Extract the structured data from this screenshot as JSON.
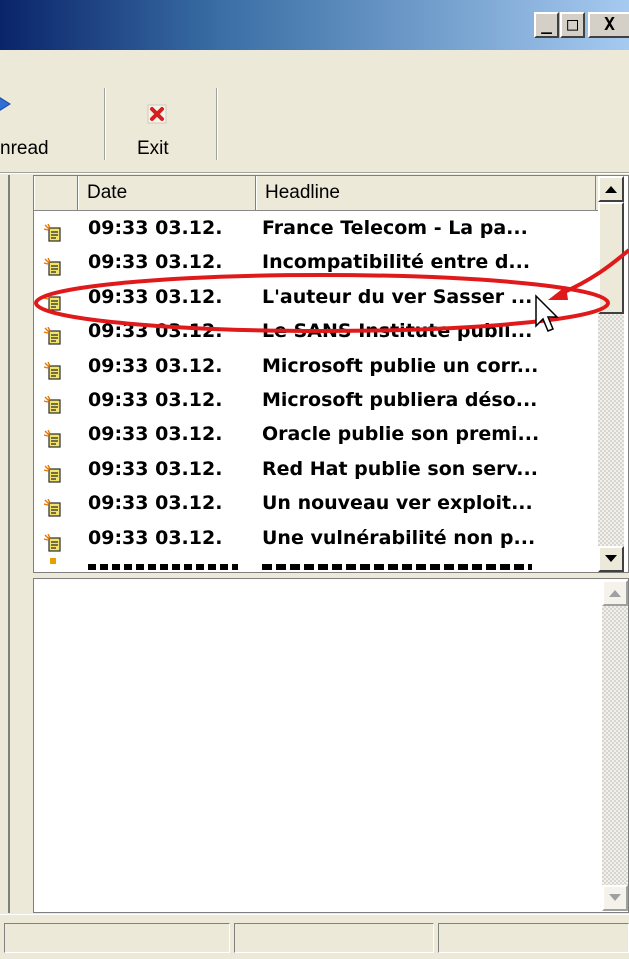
{
  "window": {
    "minimize_glyph": "_",
    "maximize_glyph": "□",
    "close_glyph": "X"
  },
  "toolbar": {
    "mark_unread_label": "nread",
    "exit_label": "Exit"
  },
  "list": {
    "columns": [
      "Date",
      "Headline"
    ],
    "rows": [
      {
        "date": "09:33 03.12.",
        "headline": "France Telecom - La pa..."
      },
      {
        "date": "09:33 03.12.",
        "headline": "Incompatibilité entre d..."
      },
      {
        "date": "09:33 03.12.",
        "headline": "L'auteur du ver Sasser ..."
      },
      {
        "date": "09:33 03.12.",
        "headline": "Le SANS Institute publi..."
      },
      {
        "date": "09:33 03.12.",
        "headline": "Microsoft publie un corr..."
      },
      {
        "date": "09:33 03.12.",
        "headline": "Microsoft publiera déso..."
      },
      {
        "date": "09:33 03.12.",
        "headline": "Oracle publie son premi..."
      },
      {
        "date": "09:33 03.12.",
        "headline": "Red Hat publie son serv..."
      },
      {
        "date": "09:33 03.12.",
        "headline": "Un nouveau ver exploit..."
      },
      {
        "date": "09:33 03.12.",
        "headline": "Une vulnérabilité non p..."
      }
    ]
  },
  "icons": {
    "row_icon": "news-item-icon",
    "exit_icon": "red-x-icon",
    "mark_unread_icon": "blue-arrow-icon"
  },
  "colors": {
    "annotation": "#e0191b",
    "exit_icon": "#d42020"
  }
}
